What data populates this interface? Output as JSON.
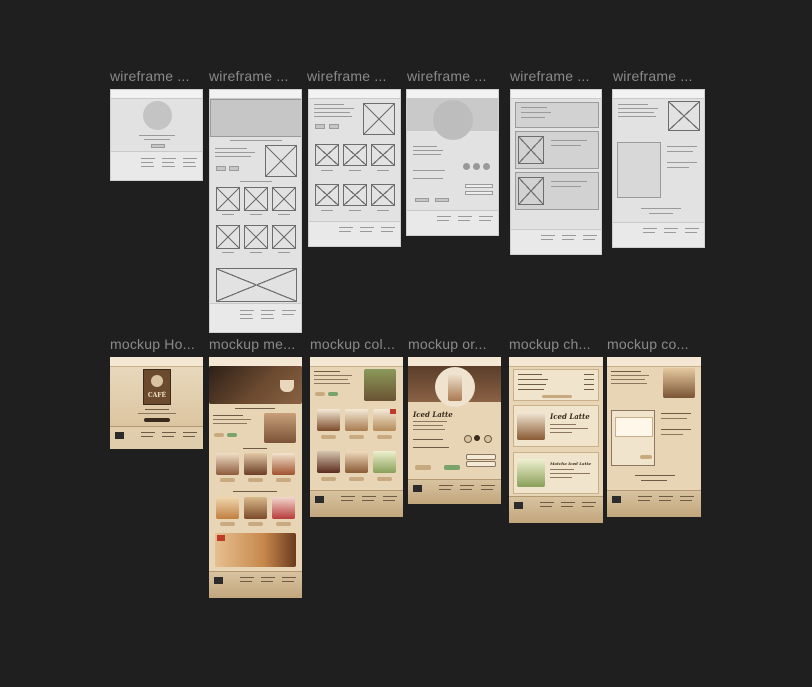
{
  "canvas": {
    "background": "#1f1f1f"
  },
  "wireframes": [
    {
      "label": "wireframe ..."
    },
    {
      "label": "wireframe ..."
    },
    {
      "label": "wireframe ..."
    },
    {
      "label": "wireframe ..."
    },
    {
      "label": "wireframe ..."
    },
    {
      "label": "wireframe ..."
    }
  ],
  "mockups": [
    {
      "label": "mockup Ho...",
      "logo_text": "CAFÉ"
    },
    {
      "label": "mockup me..."
    },
    {
      "label": "mockup col..."
    },
    {
      "label": "mockup or...",
      "product_title": "Iced Latte"
    },
    {
      "label": "mockup ch...",
      "product_title": "Iced Latte",
      "product2_title": "Matcha Iced Latte"
    },
    {
      "label": "mockup co..."
    }
  ],
  "colors": {
    "mockup_bg": "#e7d5b6",
    "accent_red": "#c0392b",
    "accent_green": "#7aa36a",
    "text_dark": "#3a2a1c"
  }
}
